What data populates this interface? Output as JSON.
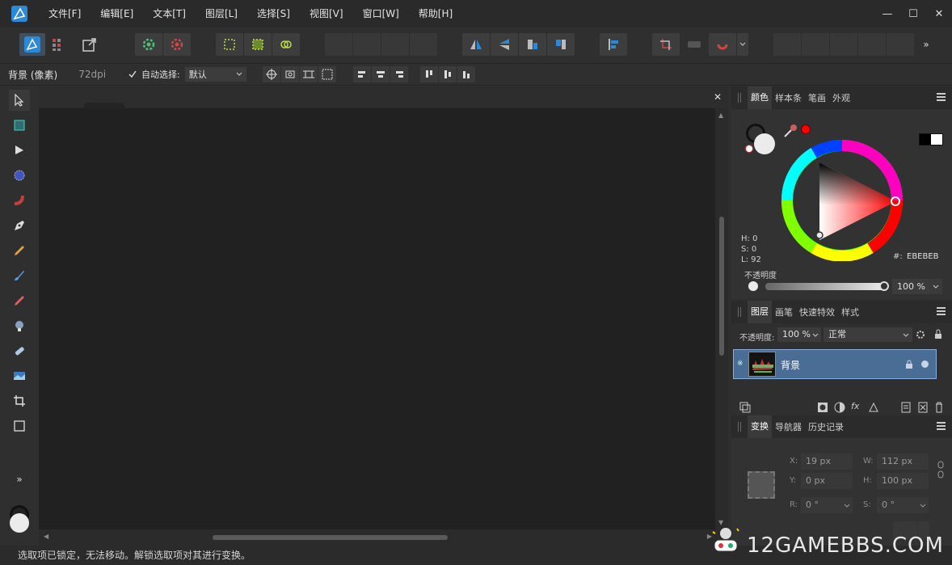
{
  "menubar": {
    "items": [
      "文件[F]",
      "编辑[E]",
      "文本[T]",
      "图层[L]",
      "选择[S]",
      "视图[V]",
      "窗口[W]",
      "帮助[H]"
    ],
    "window_controls": [
      "—",
      "☐",
      "✕"
    ]
  },
  "context": {
    "layer_name": "背景 (像素)",
    "dpi": "72dpi",
    "auto_select_label": "自动选择:",
    "auto_select_value": "默认"
  },
  "color_panel": {
    "tabs": [
      "颜色",
      "样本条",
      "笔画",
      "外观"
    ],
    "hsl": {
      "h": "H: 0",
      "s": "S: 0",
      "l": "L: 92"
    },
    "hex_label": "#:",
    "hex_value": "EBEBEB",
    "opacity_label": "不透明度",
    "opacity_value": "100 %",
    "colors": {
      "primary": "#ebebeb",
      "accent": "#ff0000"
    }
  },
  "layers_panel": {
    "tabs": [
      "图层",
      "画笔",
      "快速特效",
      "样式"
    ],
    "opacity_label": "不透明度:",
    "opacity_value": "100 %",
    "blend_mode": "正常",
    "layers": [
      {
        "name": "背景",
        "selected": true
      }
    ]
  },
  "transform_panel": {
    "tabs": [
      "变换",
      "导航器",
      "历史记录"
    ],
    "x_label": "X:",
    "x_value": "19 px",
    "y_label": "Y:",
    "y_value": "0 px",
    "w_label": "W:",
    "w_value": "112 px",
    "h_label": "H:",
    "h_value": "100 px",
    "r_label": "R:",
    "r_value": "0 °",
    "s_label": "S:",
    "s_value": "0 °"
  },
  "status": {
    "text": "选取项已锁定，无法移动。解锁选取项对其进行变换。"
  },
  "watermark": "12GAMEBBS.COM"
}
